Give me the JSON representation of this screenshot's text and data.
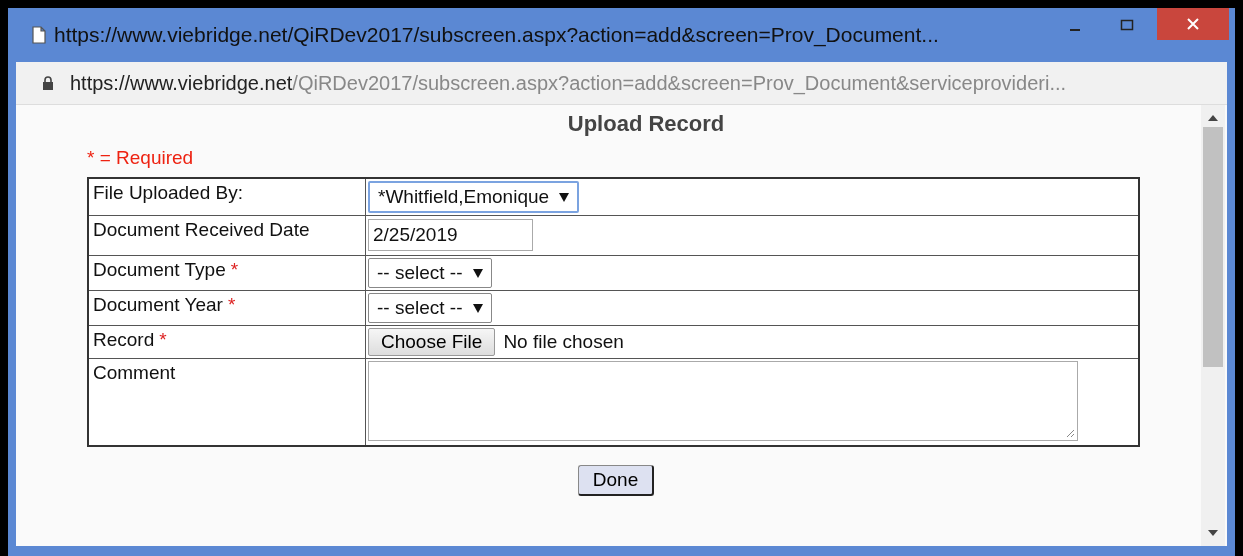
{
  "window": {
    "title": "https://www.viebridge.net/QiRDev2017/subscreen.aspx?action=add&screen=Prov_Document..."
  },
  "address_bar": {
    "host": "https://www.viebridge.net",
    "path": "/QiRDev2017/subscreen.aspx?action=add&screen=Prov_Document&serviceprovideri..."
  },
  "heading": "Upload Record",
  "required_note": "* = Required",
  "rows": [
    {
      "label": "File Uploaded By:",
      "kind": "select",
      "value": "*Whitfield,Emonique",
      "focused": true
    },
    {
      "label": "Document Received Date",
      "kind": "text",
      "value": "2/25/2019"
    },
    {
      "label": "Document Type",
      "marker": "*",
      "kind": "select",
      "value": "-- select --",
      "focused": false
    },
    {
      "label": "Document Year",
      "marker": "*",
      "kind": "select",
      "value": "-- select --",
      "focused": false
    },
    {
      "label": "Record",
      "marker": "*",
      "kind": "file",
      "button": "Choose File",
      "status": "No file chosen"
    },
    {
      "label": "Comment",
      "kind": "textarea"
    }
  ],
  "done_button": "Done"
}
